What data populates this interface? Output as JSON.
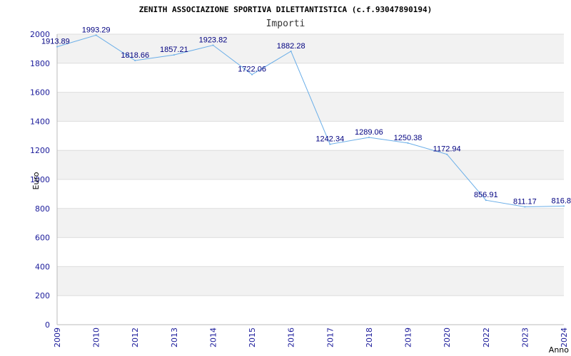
{
  "chart_data": {
    "type": "line",
    "title": "ZENITH ASSOCIAZIONE SPORTIVA DILETTANTISTICA (c.f.93047890194)",
    "subtitle": "Importi",
    "xlabel": "Anno",
    "ylabel": "Euro",
    "ylim": [
      0,
      2000
    ],
    "yticks": [
      0,
      200,
      400,
      600,
      800,
      1000,
      1200,
      1400,
      1600,
      1800,
      2000
    ],
    "grid": true,
    "x": [
      "2009",
      "2010",
      "2012",
      "2013",
      "2014",
      "2015",
      "2016",
      "2017",
      "2018",
      "2019",
      "2020",
      "2022",
      "2023",
      "2024"
    ],
    "values": [
      1913.89,
      1993.29,
      1818.66,
      1857.21,
      1923.82,
      1722.06,
      1882.28,
      1242.34,
      1289.06,
      1250.38,
      1172.94,
      856.91,
      811.17,
      816.8
    ],
    "data_labels": [
      "1913.89",
      "1993.29",
      "1818.66",
      "1857.21",
      "1923.82",
      "1722.06",
      "1882.28",
      "1242.34",
      "1289.06",
      "1250.38",
      "1172.94",
      "856.91",
      "811.17",
      "816.8"
    ],
    "colors": {
      "line": "#6aaee8",
      "band": "#f2f2f2",
      "grid": "#dddddd",
      "tick_text": "#1a1a9a",
      "label_text": "#000080"
    }
  }
}
